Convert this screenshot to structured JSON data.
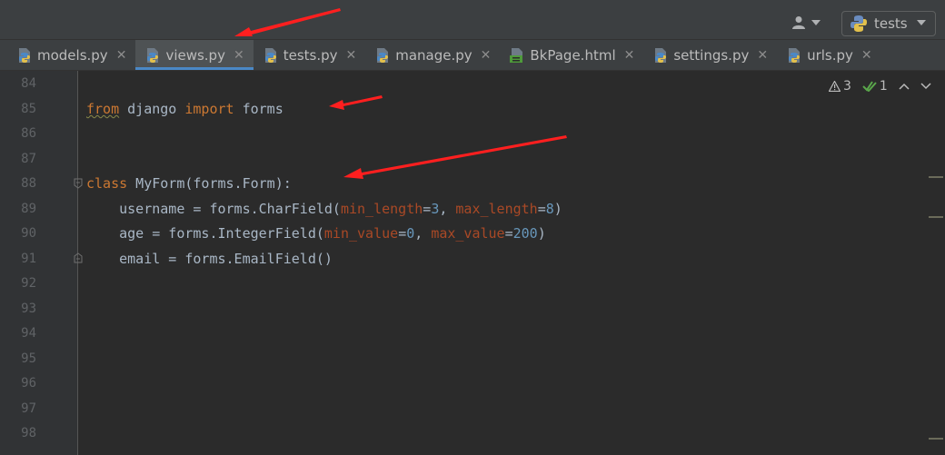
{
  "toolbar": {
    "user_icon": "user-icon",
    "run_config": {
      "label": "tests",
      "icon": "python-icon"
    }
  },
  "tabs": [
    {
      "label": "models.py",
      "icon": "python-file-icon",
      "active": false
    },
    {
      "label": "views.py",
      "icon": "python-file-icon",
      "active": true
    },
    {
      "label": "tests.py",
      "icon": "python-file-icon",
      "active": false
    },
    {
      "label": "manage.py",
      "icon": "python-file-icon",
      "active": false
    },
    {
      "label": "BkPage.html",
      "icon": "html-file-icon",
      "active": false
    },
    {
      "label": "settings.py",
      "icon": "python-file-icon",
      "active": false
    },
    {
      "label": "urls.py",
      "icon": "python-file-icon",
      "active": false
    }
  ],
  "inspections": {
    "warnings": "3",
    "ok": "1"
  },
  "line_numbers": [
    "84",
    "85",
    "86",
    "87",
    "88",
    "89",
    "90",
    "91",
    "92",
    "93",
    "94",
    "95",
    "96",
    "97",
    "98"
  ],
  "code": {
    "l85": {
      "from": "from",
      "mod": " django ",
      "import": "import",
      "name": " forms"
    },
    "l88": {
      "class": "class",
      "rest": " MyForm(forms.Form):"
    },
    "l89": {
      "a": "    username = forms.CharField(",
      "p1": "min_length",
      "e1": "=",
      "n1": "3",
      "c": ", ",
      "p2": "max_length",
      "e2": "=",
      "n2": "8",
      "z": ")"
    },
    "l90": {
      "a": "    age = forms.IntegerField(",
      "p1": "min_value",
      "e1": "=",
      "n1": "0",
      "c": ", ",
      "p2": "max_value",
      "e2": "=",
      "n2": "200",
      "z": ")"
    },
    "l91": {
      "a": "    email = forms.EmailField()"
    }
  },
  "colors": {
    "keyword": "#cc7832",
    "param": "#aa4926",
    "number": "#6897bb",
    "annotation_arrow": "#ff1f1f",
    "active_tab_underline": "#4a88c7"
  }
}
